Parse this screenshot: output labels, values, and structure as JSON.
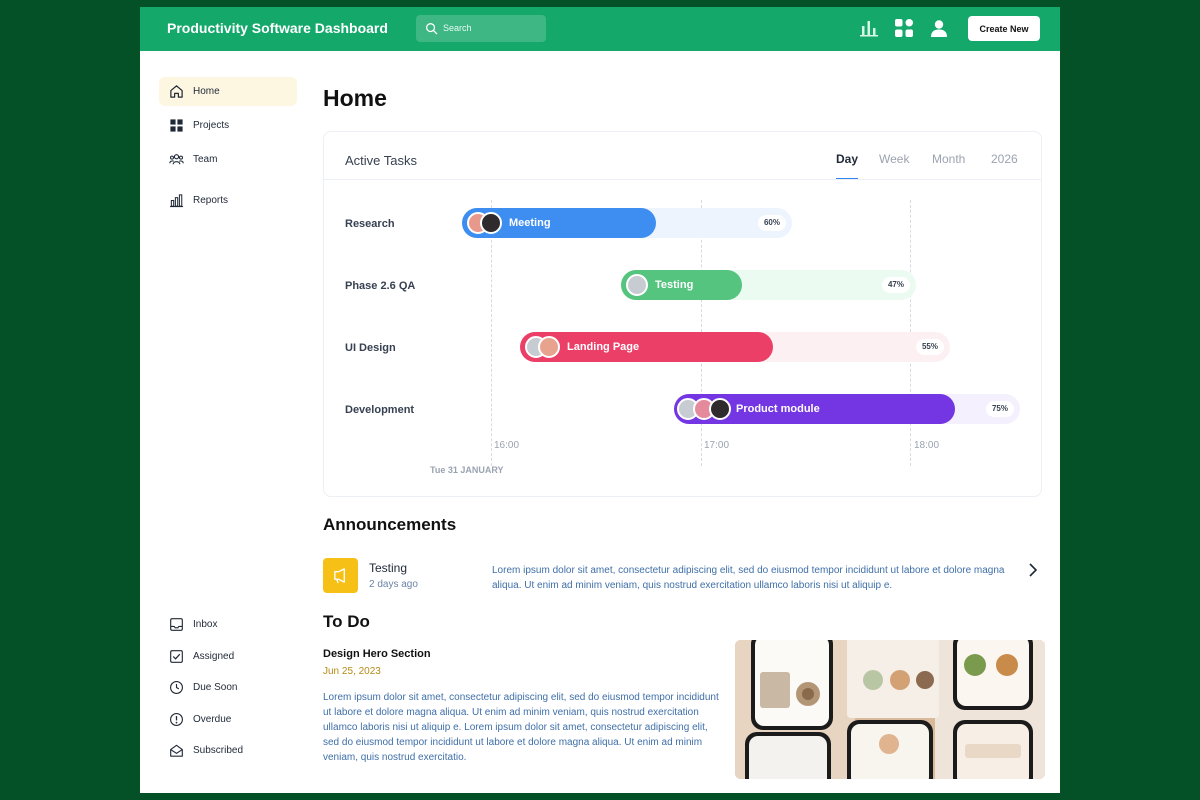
{
  "app": {
    "title": "Productivity Software Dashboard",
    "search_placeholder": "Search",
    "create_button": "Create New",
    "brand_color": "#14a86b",
    "icons": [
      "bar-chart-icon",
      "apps-grid-icon",
      "user-icon"
    ]
  },
  "sidebar": {
    "top_items": [
      {
        "label": "Home",
        "icon": "home-icon",
        "active": true
      },
      {
        "label": "Projects",
        "icon": "grid-icon"
      },
      {
        "label": "Team",
        "icon": "team-icon"
      },
      {
        "label": "Reports",
        "icon": "bar-chart-icon"
      }
    ],
    "bottom_items": [
      {
        "label": "Inbox",
        "icon": "inbox-icon"
      },
      {
        "label": "Assigned",
        "icon": "check-square-icon"
      },
      {
        "label": "Due Soon",
        "icon": "clock-icon"
      },
      {
        "label": "Overdue",
        "icon": "alert-circle-icon"
      },
      {
        "label": "Subscribed",
        "icon": "mail-open-icon"
      }
    ]
  },
  "page": {
    "title": "Home"
  },
  "active_tasks": {
    "title": "Active Tasks",
    "tabs": [
      "Day",
      "Week",
      "Month",
      "2026"
    ],
    "active_tab": "Day",
    "rows": [
      {
        "label": "Research",
        "task": "Meeting",
        "percent": "60%",
        "color": "#3d8ef0",
        "track_color": "#eef4fd"
      },
      {
        "label": "Phase 2.6 QA",
        "task": "Testing",
        "percent": "47%",
        "color": "#54c47f",
        "track_color": "#ecfbf2"
      },
      {
        "label": "UI Design",
        "task": "Landing Page",
        "percent": "55%",
        "color": "#ec3f68",
        "track_color": "#fdf0f3"
      },
      {
        "label": "Development",
        "task": "Product module",
        "percent": "75%",
        "color": "#7336e2",
        "track_color": "#f4f0fd"
      }
    ],
    "times": [
      "16:00",
      "17:00",
      "18:00"
    ],
    "date": "Tue 31 JANUARY"
  },
  "announcements": {
    "title": "Announcements",
    "items": [
      {
        "title": "Testing",
        "time": "2 days ago",
        "text": "Lorem ipsum dolor sit amet, consectetur adipiscing elit, sed do eiusmod  tempor incididunt ut labore et dolore magna aliqua. Ut enim ad minim  veniam, quis nostrud exercitation ullamco laboris nisi ut aliquip e."
      }
    ]
  },
  "todo": {
    "title": "To Do",
    "item_title": "Design Hero Section",
    "item_date": "Jun 25, 2023",
    "item_text": "Lorem ipsum dolor sit amet, consectetur adipiscing elit, sed do eiusmod  tempor incididunt ut labore et dolore magna aliqua. Ut enim ad minim  veniam, quis nostrud exercitation ullamco laboris nisi ut aliquip e. Lorem ipsum dolor sit amet, consectetur adipiscing elit, sed do eiusmod  tempor incididunt ut labore et dolore magna aliqua. Ut enim ad minim  veniam, quis nostrud exercitatio."
  }
}
